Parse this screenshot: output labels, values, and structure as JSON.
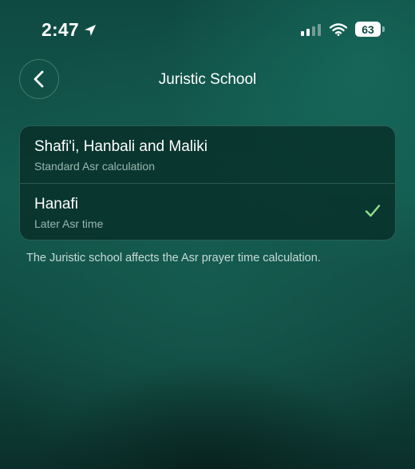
{
  "status_bar": {
    "time": "2:47",
    "battery_level": "63",
    "icons": [
      "location-arrow-icon",
      "cellular-signal-icon",
      "wifi-icon",
      "battery-icon"
    ]
  },
  "nav": {
    "back_icon": "chevron-left-icon",
    "title": "Juristic School"
  },
  "options": [
    {
      "title": "Shafi'i, Hanbali and Maliki",
      "subtitle": "Standard Asr calculation",
      "selected": false
    },
    {
      "title": "Hanafi",
      "subtitle": "Later Asr time",
      "selected": true
    }
  ],
  "footnote": "The Juristic school affects the Asr prayer time calculation.",
  "colors": {
    "accent_check": "#8fe08a",
    "background": "#135a4f"
  }
}
